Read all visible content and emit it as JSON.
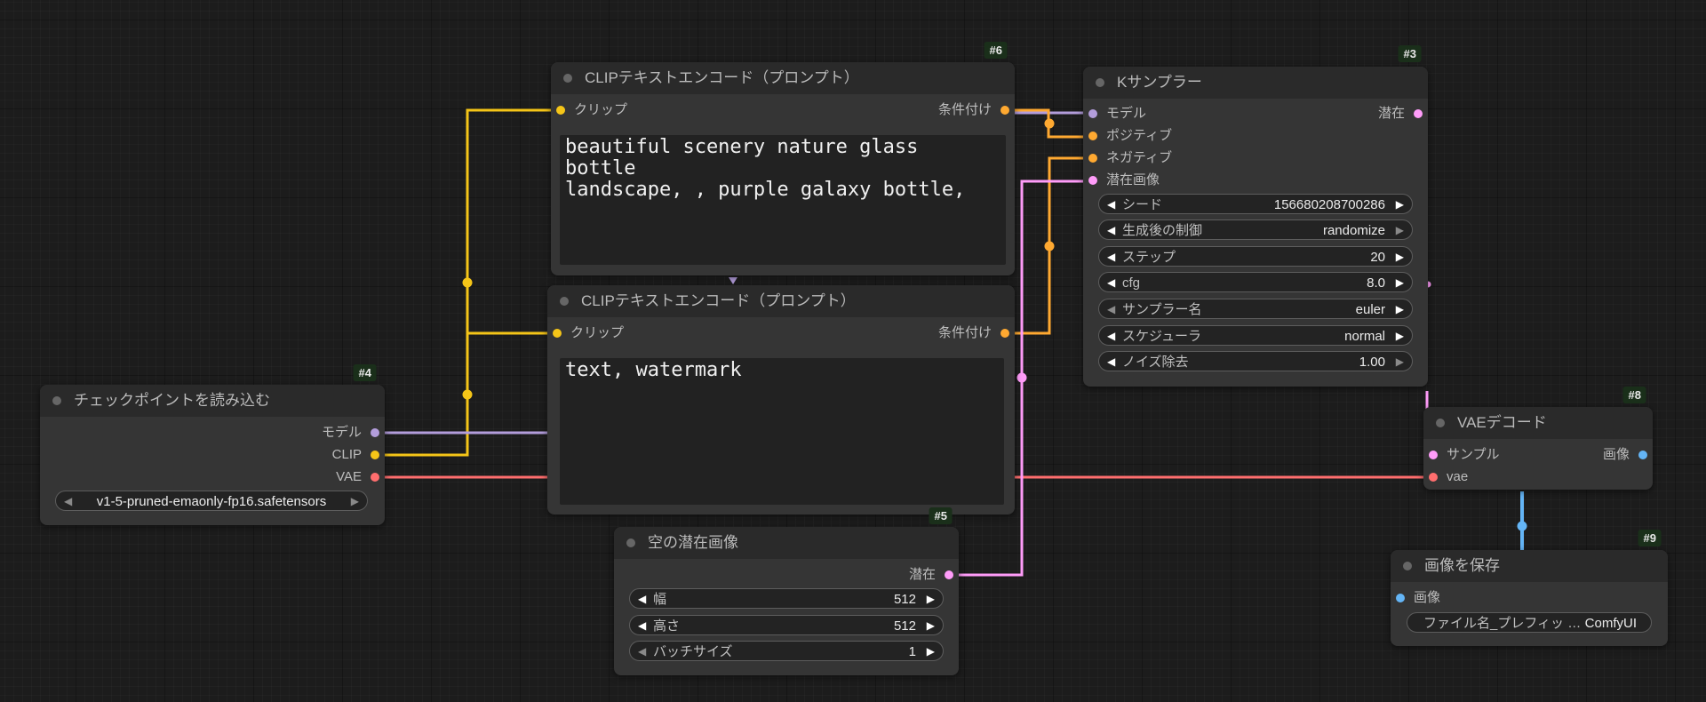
{
  "colors": {
    "clip": "#f5c518",
    "model": "#b39ddb",
    "vae": "#ff6e6e",
    "conditioning": "#ffa931",
    "latent": "#ff9cf9",
    "image": "#64b5f6"
  },
  "nodes": {
    "checkpoint": {
      "id": "#4",
      "title": "チェックポイントを読み込む",
      "outputs": [
        "モデル",
        "CLIP",
        "VAE"
      ],
      "ckpt_name": "v1-5-pruned-emaonly-fp16.safetensors"
    },
    "clip_pos": {
      "id": "#6",
      "title": "CLIPテキストエンコード（プロンプト）",
      "input": "クリップ",
      "output": "条件付け",
      "text": "beautiful scenery nature glass bottle\nlandscape, , purple galaxy bottle,"
    },
    "clip_neg": {
      "id": "#7",
      "title": "CLIPテキストエンコード（プロンプト）",
      "input": "クリップ",
      "output": "条件付け",
      "text": "text, watermark"
    },
    "ksampler": {
      "id": "#3",
      "title": "Kサンプラー",
      "inputs": [
        "モデル",
        "ポジティブ",
        "ネガティブ",
        "潜在画像"
      ],
      "output": "潜在",
      "widgets": [
        {
          "label": "シード",
          "value": "156680208700286"
        },
        {
          "label": "生成後の制御",
          "value": "randomize"
        },
        {
          "label": "ステップ",
          "value": "20"
        },
        {
          "label": "cfg",
          "value": "8.0"
        },
        {
          "label": "サンプラー名",
          "value": "euler"
        },
        {
          "label": "スケジューラ",
          "value": "normal"
        },
        {
          "label": "ノイズ除去",
          "value": "1.00"
        }
      ]
    },
    "empty_latent": {
      "id": "#5",
      "title": "空の潜在画像",
      "output": "潜在",
      "widgets": [
        {
          "label": "幅",
          "value": "512"
        },
        {
          "label": "高さ",
          "value": "512"
        },
        {
          "label": "バッチサイズ",
          "value": "1"
        }
      ]
    },
    "vae_decode": {
      "id": "#8",
      "title": "VAEデコード",
      "inputs": [
        "サンプル",
        "vae"
      ],
      "output": "画像"
    },
    "save_image": {
      "id": "#9",
      "title": "画像を保存",
      "input": "画像",
      "prefix_label": "ファイル名_プレフィッ …",
      "prefix_value": "ComfyUI"
    }
  }
}
